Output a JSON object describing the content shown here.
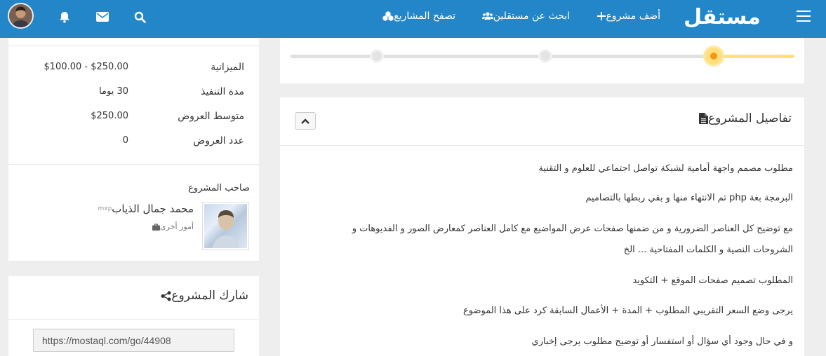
{
  "navbar": {
    "logo": "مستقل",
    "add_project": "أضف مشروع",
    "find_freelancers": "ابحث عن مستقلين",
    "browse_projects": "تصفح المشاريع"
  },
  "icons": {
    "menu": "hamburger-icon",
    "add": "plus-icon",
    "freelancers": "users-icon",
    "browse": "cubes-icon",
    "search": "search-icon",
    "messages": "envelope-icon",
    "notifications": "bell-icon",
    "details": "file-icon",
    "collapse": "chevron-up-icon",
    "share": "share-icon",
    "role": "briefcase-icon"
  },
  "progress": {
    "steps": 3,
    "current_step": 1,
    "colors": {
      "active": "#ffe07a",
      "dot": "#f7941d",
      "track": "#e0e0e0"
    }
  },
  "details": {
    "title": "تفاصيل المشروع",
    "paragraphs": [
      "مطلوب مصمم واجهة أمامية لشبكة تواصل اجتماعي للعلوم و التقنية",
      "البرمجة بغة php تم الانتهاء منها و بقي ربطها بالتصاميم",
      "مع توضيح كل العناصر الضرورية و من ضمنها صفحات عرض المواضيع مع كامل العناصر كمعارض الصور و الفديوهات و",
      "الشروحات النصية و الكلمات المفتاحية ... الخ",
      "المطلوب تصميم صفحات الموقع + التكويد",
      "يرجى وضع السعر التقريبي المطلوب + المدة + الأعمال السابقة كرد على هذا الموضوع",
      "و في حال وجود أي سؤال أو استفسار أو توضيح مطلوب يرجى إخباري"
    ]
  },
  "summary": {
    "rows": [
      {
        "label": "الميزانية",
        "value": "$100.00 - $250.00"
      },
      {
        "label": "مدة التنفيذ",
        "value": "30 يوما"
      },
      {
        "label": "متوسط العروض",
        "value": "$250.00"
      },
      {
        "label": "عدد العروض",
        "value": "0"
      }
    ]
  },
  "owner": {
    "section_label": "صاحب المشروع",
    "name": "محمد جمال الذياب",
    "tag": "mxp",
    "role": "أمور أخرى"
  },
  "share": {
    "title": "شارك المشروع",
    "url": "https://mostaql.com/go/44908"
  },
  "colors": {
    "brand": "#2386c8",
    "background": "#eeeeee"
  }
}
